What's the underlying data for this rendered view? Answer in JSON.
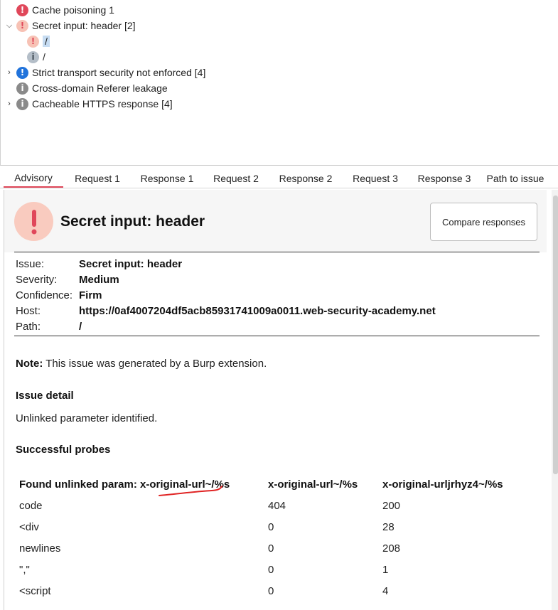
{
  "tree": {
    "rows": [
      {
        "label": "Cache poisoning 1",
        "icon_severity": "high"
      },
      {
        "label": "Secret input: header [2]",
        "icon_severity": "medium",
        "expanded": true
      },
      {
        "label": "/",
        "icon_severity": "medium",
        "selected": true
      },
      {
        "label": "/",
        "icon_severity": "information"
      },
      {
        "label": "Strict transport security not enforced [4]",
        "icon_severity": "low"
      },
      {
        "label": "Cross-domain Referer leakage",
        "icon_severity": "information"
      },
      {
        "label": "Cacheable HTTPS response [4]",
        "icon_severity": "information"
      }
    ]
  },
  "tabs": [
    "Advisory",
    "Request 1",
    "Response 1",
    "Request 2",
    "Response 2",
    "Request 3",
    "Response 3",
    "Path to issue"
  ],
  "active_tab": "Advisory",
  "advisory": {
    "title": "Secret input: header",
    "compare_button": "Compare responses",
    "meta": [
      {
        "label": "Issue:",
        "value": "Secret input: header"
      },
      {
        "label": "Severity:",
        "value": "Medium"
      },
      {
        "label": "Confidence:",
        "value": "Firm"
      },
      {
        "label": "Host:",
        "value": "https://0af4007204df5acb85931741009a0011.web-security-academy.net"
      },
      {
        "label": "Path:",
        "value": "/"
      }
    ],
    "note_label": "Note:",
    "note_text": " This issue was generated by a Burp extension.",
    "detail_heading": "Issue detail",
    "detail_text": "Unlinked parameter identified.",
    "probes_heading": "Successful probes",
    "probes_table": {
      "headers": [
        "Found unlinked param: x-original-url~/%s",
        "x-original-url~/%s",
        "x-original-urljrhyz4~/%s"
      ],
      "rows": [
        [
          "code",
          "404",
          "200"
        ],
        [
          "<div",
          "0",
          "28"
        ],
        [
          "newlines",
          "0",
          "208"
        ],
        [
          "\",\"",
          "0",
          "1"
        ],
        [
          "<script",
          "0",
          "4"
        ]
      ]
    }
  },
  "colors": {
    "accent": "#e0475a",
    "medium_icon_bg": "#f9cbbf",
    "low_icon": "#2173db",
    "info_icon": "#8a8a8a"
  }
}
